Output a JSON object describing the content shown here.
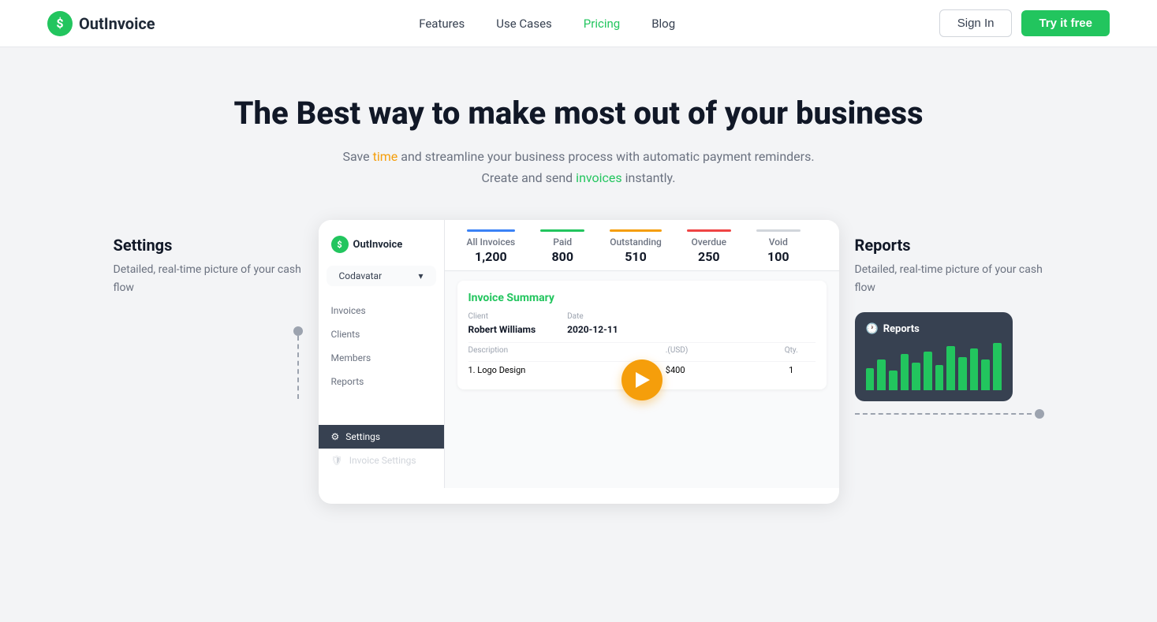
{
  "navbar": {
    "logo_text": "OutInvoice",
    "logo_icon": "$",
    "nav": [
      {
        "label": "Features",
        "href": "#",
        "active": false
      },
      {
        "label": "Use Cases",
        "href": "#",
        "active": false
      },
      {
        "label": "Pricing",
        "href": "#",
        "active": true
      },
      {
        "label": "Blog",
        "href": "#",
        "active": false
      }
    ],
    "sign_in": "Sign In",
    "try_free": "Try it free"
  },
  "hero": {
    "heading": "The Best way to make most out of your business",
    "subtext_before": "Save ",
    "subtext_time": "time",
    "subtext_middle": " and streamline your business process with automatic payment reminders. Create and send ",
    "subtext_invoices": "invoices",
    "subtext_end": " instantly."
  },
  "features": {
    "left": {
      "title": "Settings",
      "description": "Detailed, real-time picture of your cash flow"
    },
    "right": {
      "title": "Reports",
      "description": "Detailed, real-time picture of your cash flow"
    }
  },
  "dashboard": {
    "logo_text": "OutInvoice",
    "logo_icon": "$",
    "dropdown_label": "Codavatar",
    "nav_items": [
      "Invoices",
      "Clients",
      "Members",
      "Reports"
    ],
    "settings_label": "Settings",
    "invoice_settings_label": "Invoice Settings",
    "tabs": [
      {
        "label": "All Invoices",
        "count": "1,200",
        "color": "blue"
      },
      {
        "label": "Paid",
        "count": "800",
        "color": "green"
      },
      {
        "label": "Outstanding",
        "count": "510",
        "color": "yellow"
      },
      {
        "label": "Overdue",
        "count": "250",
        "color": "red"
      },
      {
        "label": "Void",
        "count": "100",
        "color": "gray"
      }
    ],
    "invoice_summary": {
      "title_before": "Invoice ",
      "title_highlight": "Summary",
      "client_label": "Client",
      "client_value": "Robert Williams",
      "date_label": "Date",
      "date_value": "2020-12-11",
      "desc_label": "Description",
      "price_label": ".(USD)",
      "qty_label": "Qty.",
      "items": [
        {
          "description": "1. Logo Design",
          "price": "$400",
          "qty": "1"
        }
      ]
    }
  },
  "reports_card": {
    "title": "Reports",
    "bars": [
      40,
      55,
      35,
      65,
      50,
      70,
      45,
      80,
      60,
      75,
      55,
      85
    ]
  }
}
